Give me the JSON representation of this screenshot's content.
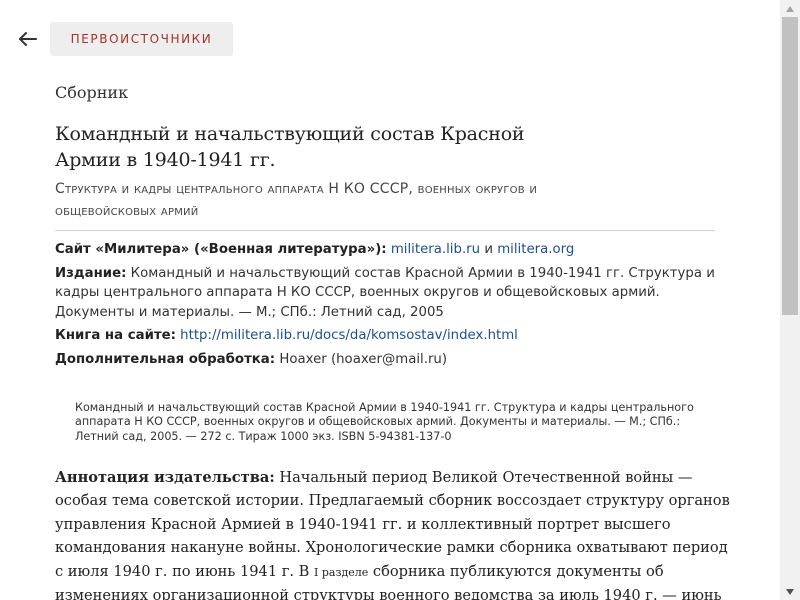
{
  "nav": {
    "back_icon": "arrow-left-icon",
    "section_label": "ПЕРВОИСТОЧНИКИ"
  },
  "book": {
    "kind": "Сборник",
    "title": "Командный и начальствующий состав Красной Армии в 1940-1941 гг.",
    "subtitle": "Структура и кадры центрального аппарата Н КО СССР, военных округов и общевойсковых армий"
  },
  "meta": {
    "site_label": "Сайт «Милитера» («Военная литература»):",
    "site_link1": "militera.lib.ru",
    "site_and": "и",
    "site_link2": "militera.org",
    "edition_label": "Издание:",
    "edition_text": "Командный и начальствующий состав Красной Армии в 1940-1941 гг. Структура и кадры центрального аппарата Н КО СССР, военных округов и общевойсковых армий. Документы и материалы. — М.; СПб.: Летний сад, 2005",
    "book_label": "Книга на сайте:",
    "book_link": "http://militera.lib.ru/docs/da/komsostav/index.html",
    "processing_label": "Дополнительная обработка:",
    "processing_text": "Hoaxer (hoaxer@mail.ru)"
  },
  "biblio": "Командный и начальствующий состав Красной Армии в 1940-1941 гг. Структура и кадры центрального аппарата Н КО СССР, военных округов и общевойсковых армий. Документы и материалы. — М.; СПб.: Летний сад, 2005. — 272 с. Тираж 1000 экз. ISBN 5-94381-137-0",
  "annotation": {
    "lead": "Аннотация издательства:",
    "text1": "Начальный период Великой Отечественной войны — особая тема советской истории. Предлагаемый сборник воссоздает структуру органов управления Красной Армией в 1940-1941 гг. и коллективный портрет высшего командования накануне войны. Хронологические рамки сборника охватывают период с июля 1940 г. по июнь 1941 г. В",
    "small": "I разделе",
    "text2": "сборника публикуются документы об изменениях организационной структуры военного ведомства за июль 1940 г. — июнь"
  },
  "scrollbar": {
    "up_icon": "scroll-up-arrow-icon",
    "down_icon": "scroll-down-arrow-icon"
  }
}
